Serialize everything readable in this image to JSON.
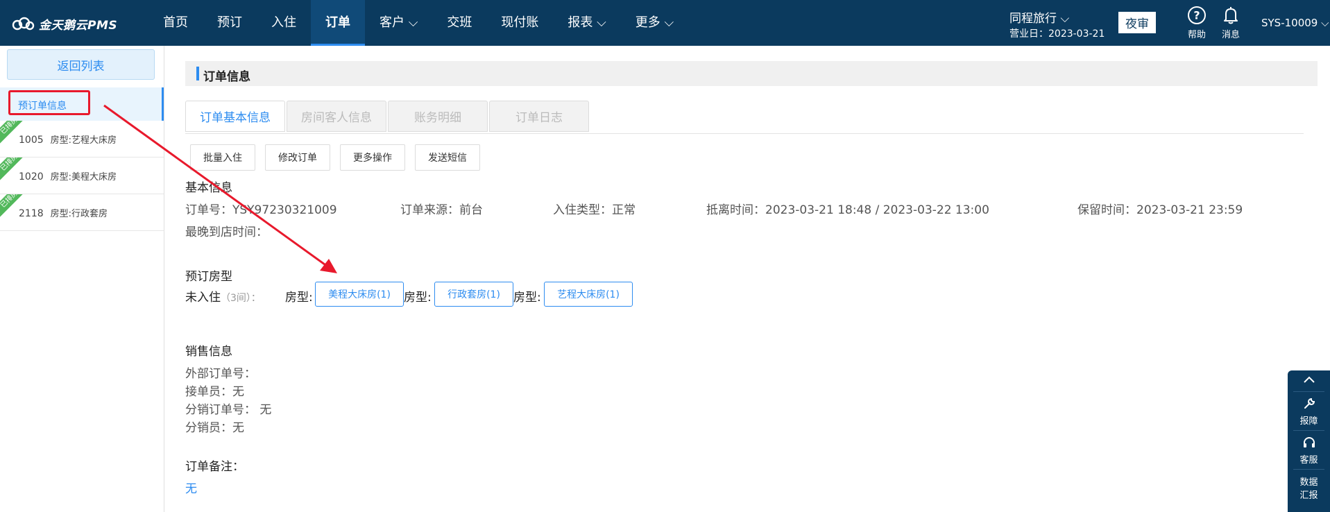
{
  "header": {
    "logo_text": "金天鹅云PMS",
    "nav": [
      {
        "label": "首页"
      },
      {
        "label": "预订"
      },
      {
        "label": "入住"
      },
      {
        "label": "订单"
      },
      {
        "label": "客户 ⌵"
      },
      {
        "label": "交班"
      },
      {
        "label": "现付账"
      },
      {
        "label": "报表 ⌵"
      },
      {
        "label": "更多 ⌵"
      }
    ],
    "active_nav": "订单",
    "hotel": "同程旅行 ⌵",
    "business_date": "营业日：2023-03-21",
    "night_audit": "夜审",
    "help_label": "帮助",
    "message_label": "消息",
    "user": "SYS-10009 ⌵"
  },
  "sidebar": {
    "back_label": "返回列表",
    "pre_order_label": "预订单信息",
    "rooms": [
      {
        "badge": "已排房",
        "number": "1005",
        "type": "房型:艺程大床房"
      },
      {
        "badge": "已排房",
        "number": "1020",
        "type": "房型:美程大床房"
      },
      {
        "badge": "已排房",
        "number": "2118",
        "type": "房型:行政套房"
      }
    ]
  },
  "main": {
    "section_title": "订单信息",
    "tabs": [
      {
        "label": "订单基本信息"
      },
      {
        "label": "房间客人信息"
      },
      {
        "label": "账务明细"
      },
      {
        "label": "订单日志"
      }
    ],
    "actions": [
      {
        "label": "批量入住"
      },
      {
        "label": "修改订单"
      },
      {
        "label": "更多操作"
      },
      {
        "label": "发送短信"
      }
    ],
    "basic": {
      "title": "基本信息",
      "order_no": "订单号：YSY97230321009",
      "source": "订单来源：前台",
      "checkin_type": "入住类型：正常",
      "stay_time": "抵离时间：2023-03-21 18:48 / 2023-03-22 13:00",
      "hold_time": "保留时间：2023-03-21 23:59",
      "latest_arrival": "最晚到店时间："
    },
    "room_types": {
      "title": "预订房型",
      "status": "未入住",
      "count": "（3间）：",
      "prefix": "房型:",
      "items": [
        "美程大床房(1)",
        "行政套房(1)",
        "艺程大床房(1)"
      ]
    },
    "sales": {
      "title": "销售信息",
      "external_no": "外部订单号：",
      "receiver": "接单员：无",
      "dist_no": "分销订单号： 无",
      "distributor": "分销员：无"
    },
    "remark": {
      "title": "订单备注：",
      "value": "无"
    }
  },
  "side_panel": {
    "report_issue": "报障",
    "service": "客服",
    "data_report_1": "数据",
    "data_report_2": "汇报"
  },
  "colors": {
    "header_bg": "#0b3a5e",
    "accent": "#2d8cf0",
    "annotation_red": "#e8192c",
    "badge_green": "#52b85b"
  }
}
